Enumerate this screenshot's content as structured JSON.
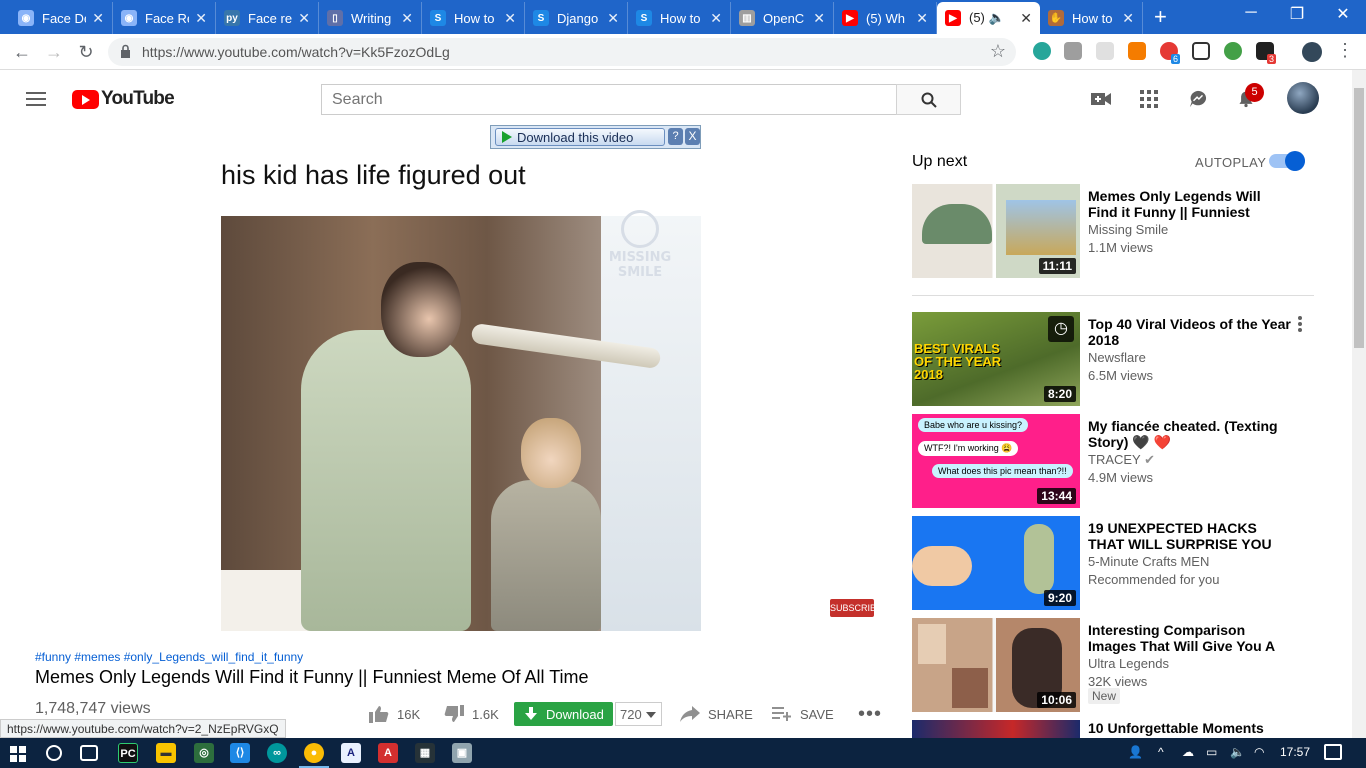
{
  "browser": {
    "tabs": [
      {
        "title": "Face De",
        "icon": "brain-icon",
        "color": "#8ab4f8"
      },
      {
        "title": "Face Re",
        "icon": "brain-icon",
        "color": "#8ab4f8"
      },
      {
        "title": "Face re",
        "icon": "py-icon",
        "color": "#3776ab"
      },
      {
        "title": "Writing",
        "icon": "page-icon",
        "color": "#5f6fa8"
      },
      {
        "title": "How to",
        "icon": "stackoverflow-icon",
        "color": "#1e88e5"
      },
      {
        "title": "Django",
        "icon": "stackoverflow-icon",
        "color": "#1e88e5"
      },
      {
        "title": "How to",
        "icon": "stackoverflow-icon",
        "color": "#1e88e5"
      },
      {
        "title": "OpenC",
        "icon": "book-icon",
        "color": "#9e9e9e"
      },
      {
        "title": "(5) Wh",
        "icon": "youtube-icon",
        "color": "#ff0000"
      },
      {
        "title": "(5)",
        "icon": "youtube-icon",
        "color": "#ff0000"
      },
      {
        "title": "How to",
        "icon": "hand-icon",
        "color": "#b06b3b"
      }
    ],
    "url": "https://www.youtube.com/watch?v=Kk5FzozOdLg",
    "extension_badges": [
      "6",
      "3"
    ],
    "status_url": "https://www.youtube.com/watch?v=2_NzEpRVGxQ"
  },
  "youtube": {
    "logo_text": "YouTube",
    "search_placeholder": "Search",
    "notification_count": "5",
    "download_overlay": {
      "label": "Download this video",
      "help": "?",
      "close": "X"
    },
    "video": {
      "caption": "his kid has life figured out",
      "watermark": "MISSING SMILE",
      "subscribe_watermark": "SUBSCRIBE",
      "hashtags": "#funny #memes #only_Legends_will_find_it_funny",
      "title": "Memes Only Legends Will Find it Funny || Funniest Meme Of All Time",
      "views": "1,748,747 views",
      "likes": "16K",
      "dislikes": "1.6K",
      "download_label": "Download",
      "quality": "720",
      "share_label": "SHARE",
      "save_label": "SAVE"
    },
    "sidebar": {
      "up_next": "Up next",
      "autoplay": "AUTOPLAY",
      "autoplay_on": true,
      "recommendations": [
        {
          "title": "Memes Only Legends Will Find it Funny || Funniest Meme Of A...",
          "channel": "Missing Smile",
          "views": "1.1M views",
          "duration": "11:11"
        },
        {
          "title": "Top 40 Viral Videos of the Year 2018",
          "channel": "Newsflare",
          "views": "6.5M views",
          "duration": "8:20",
          "thumb_text": "BEST VIRALS OF THE YEAR 2018"
        },
        {
          "title": "My fiancée cheated. (Texting Story) 🖤 ❤️",
          "channel": "TRACEY",
          "views": "4.9M views",
          "duration": "13:44",
          "chat": [
            "Babe who are u kissing?",
            "WTF?! I'm working 😩",
            "What does this pic mean than?!!"
          ]
        },
        {
          "title": "19 UNEXPECTED HACKS THAT WILL SURPRISE YOU",
          "channel": "5-Minute Crafts MEN",
          "views": "Recommended for you",
          "duration": "9:20"
        },
        {
          "title": "Interesting Comparison Images That Will Give You A Different...",
          "channel": "Ultra Legends",
          "views": "32K views",
          "duration": "10:06",
          "badge": "New"
        },
        {
          "title": "10 Unforgettable Moments",
          "channel": "",
          "views": "",
          "duration": ""
        }
      ]
    }
  },
  "taskbar": {
    "time": "17:57"
  }
}
